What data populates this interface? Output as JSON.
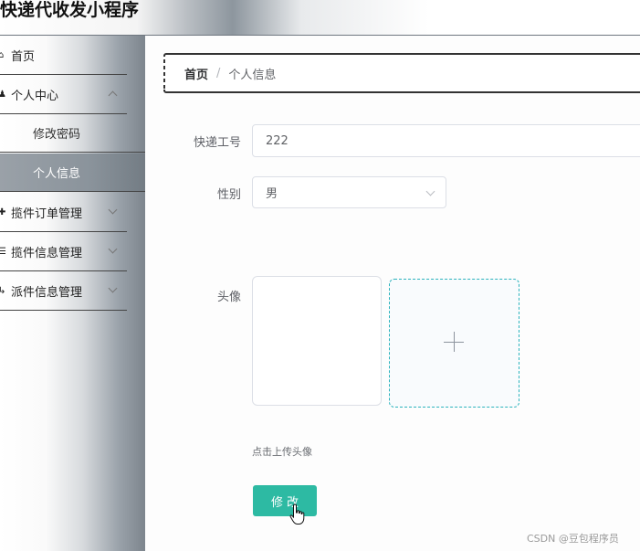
{
  "app": {
    "title": "快递代收发小程序"
  },
  "sidebar": {
    "items": [
      {
        "icon": "home-icon",
        "label": "首页"
      },
      {
        "icon": "user-icon",
        "label": "个人中心",
        "expanded": true,
        "children": [
          {
            "label": "修改密码",
            "active": false
          },
          {
            "label": "个人信息",
            "active": true
          }
        ]
      },
      {
        "icon": "package-icon",
        "label": "揽件订单管理"
      },
      {
        "icon": "list-icon",
        "label": "揽件信息管理"
      },
      {
        "icon": "truck-icon",
        "label": "派件信息管理"
      }
    ]
  },
  "breadcrumb": {
    "home": "首页",
    "separator": "/",
    "current": "个人信息"
  },
  "form": {
    "employee_id": {
      "label": "快递工号",
      "value": "222"
    },
    "gender": {
      "label": "性别",
      "value": "男"
    },
    "avatar": {
      "label": "头像",
      "upload_hint": "点击上传头像"
    },
    "submit_label": "修改"
  },
  "watermark": "CSDN @豆包程序员",
  "colors": {
    "primary_button": "#2dbaa3",
    "upload_border": "#2bb3bd"
  }
}
